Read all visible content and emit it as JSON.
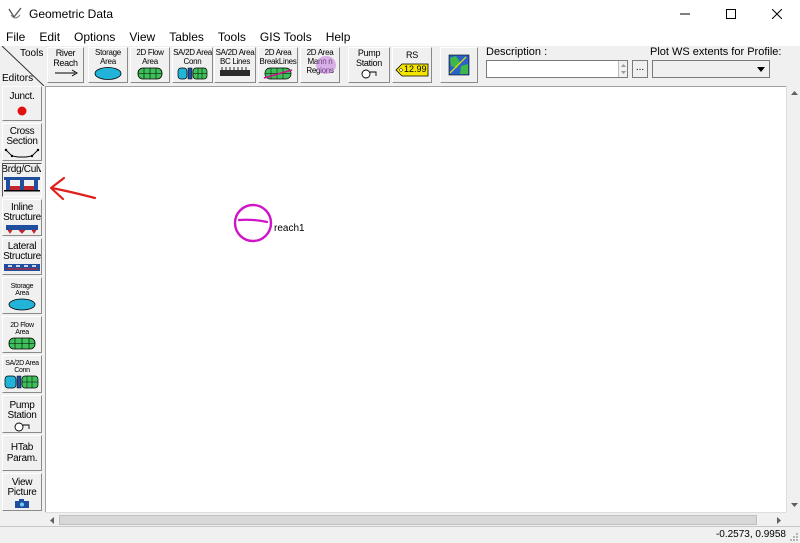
{
  "window": {
    "title": "Geometric Data"
  },
  "menu": [
    "File",
    "Edit",
    "Options",
    "View",
    "Tables",
    "Tools",
    "GIS Tools",
    "Help"
  ],
  "toolbar": {
    "tools_label": "Tools",
    "editors_label": "Editors",
    "river_reach": [
      "River",
      "Reach"
    ],
    "storage_area": [
      "Storage",
      "Area"
    ],
    "flow_area_2d": [
      "2D Flow",
      "Area"
    ],
    "sa_2d_conn": [
      "SA/2D Area",
      "Conn"
    ],
    "sa_2d_bc": [
      "SA/2D Area",
      "BC Lines"
    ],
    "breaklines": [
      "2D Area",
      "BreakLines"
    ],
    "mann_n": [
      "2D Area",
      "Mann n",
      "Regions"
    ],
    "pump_station": [
      "Pump",
      "Station"
    ],
    "rs": {
      "label": "RS",
      "value": "12.99"
    },
    "description_label": "Description :",
    "description_value": "",
    "more_button": "...",
    "plot_ws_label": "Plot WS extents for Profile:",
    "plot_ws_value": ""
  },
  "editors": {
    "junct": "Junct.",
    "cross_section": [
      "Cross",
      "Section"
    ],
    "brdg_culv": "Brdg/Culv",
    "inline_structure": [
      "Inline",
      "Structure"
    ],
    "lateral_structure": [
      "Lateral",
      "Structure"
    ],
    "storage_area": [
      "Storage",
      "Area"
    ],
    "flow_area_2d": [
      "2D Flow",
      "Area"
    ],
    "sa_2d_conn": [
      "SA/2D Area",
      "Conn"
    ],
    "pump_station": [
      "Pump",
      "Station"
    ],
    "htab": [
      "HTab",
      "Param."
    ],
    "view_picture": [
      "View",
      "Picture"
    ]
  },
  "canvas": {
    "reach_label": "reach1"
  },
  "status": {
    "coords": "-0.2573, 0.9958"
  },
  "colors": {
    "accent_blue": "#1f4e9e",
    "annotation_red": "#e0201c",
    "annotation_magenta": "#d014c8",
    "rs_tag": "#f5e600"
  }
}
